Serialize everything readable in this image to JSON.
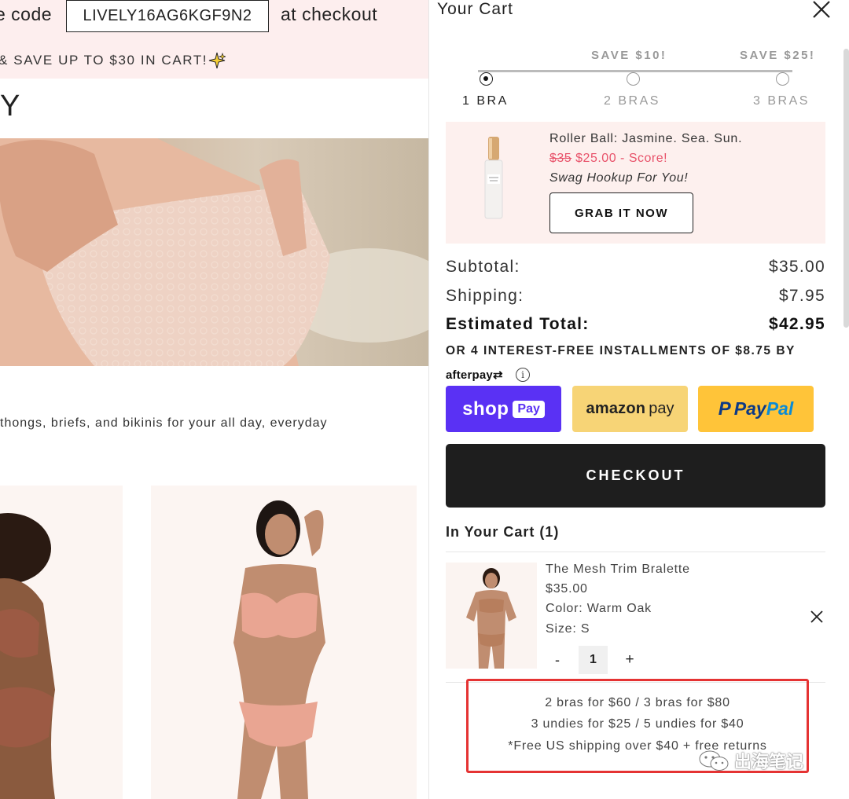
{
  "promo": {
    "code_prefix": "e code",
    "code": "LIVELY16AG6KGF9N2",
    "code_suffix": "at checkout",
    "banner_text": "& SAVE UP TO $30 IN CART!"
  },
  "page": {
    "heading": "Y",
    "description": "thongs, briefs, and bikinis for your all day, everyday"
  },
  "cart": {
    "title": "Your Cart",
    "tiers": [
      {
        "savings": "",
        "label": "1 BRA",
        "active": true
      },
      {
        "savings": "SAVE $10!",
        "label": "2 BRAS",
        "active": false
      },
      {
        "savings": "SAVE $25!",
        "label": "3 BRAS",
        "active": false
      }
    ],
    "upsell": {
      "name": "Roller Ball: Jasmine. Sea. Sun.",
      "old_price": "$35",
      "new_price": "$25.00 - Score!",
      "note": "Swag Hookup For You!",
      "button": "GRAB IT NOW"
    },
    "summary": {
      "subtotal_label": "Subtotal:",
      "subtotal_value": "$35.00",
      "shipping_label": "Shipping:",
      "shipping_value": "$7.95",
      "total_label": "Estimated Total:",
      "total_value": "$42.95"
    },
    "installments": "OR 4 INTEREST-FREE INSTALLMENTS OF $8.75 BY",
    "afterpay": "afterpay",
    "payment": {
      "shop_word": "shop",
      "shop_pill": "Pay",
      "amazon_word": "amazon",
      "amazon_pay": "pay",
      "paypal_pay": "Pay",
      "paypal_pal": "Pal"
    },
    "checkout_label": "CHECKOUT",
    "in_cart_heading": "In Your Cart (1)",
    "line_item": {
      "name": "The Mesh Trim Bralette",
      "price": "$35.00",
      "color": "Color: Warm Oak",
      "size": "Size: S",
      "quantity": "1",
      "minus": "-",
      "plus": "+"
    },
    "offers": [
      "2 bras for $60 / 3 bras for $80",
      "3 undies for $25 / 5 undies for $40",
      "*Free US shipping over $40 + free returns"
    ]
  },
  "watermark": "出海笔记",
  "colors": {
    "promo_bg": "#fdeeee",
    "sale_red": "#e8526a",
    "shop_pay": "#5a31f4",
    "amazon_pay": "#f7d476",
    "paypal": "#ffc439",
    "checkout_bg": "#1e1e1e",
    "highlight_red": "#e53333"
  }
}
